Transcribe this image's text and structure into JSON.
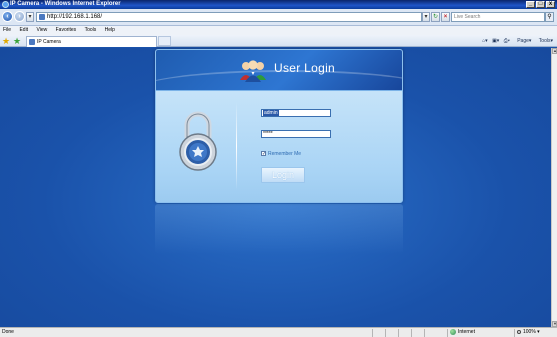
{
  "window": {
    "title": "IP Camera - Windows Internet Explorer",
    "minimize_glyph": "_",
    "maximize_glyph": "□",
    "close_glyph": "x"
  },
  "address_bar": {
    "url": "http://192.168.1.168/",
    "back_icon": "back-arrow-icon",
    "forward_icon": "forward-arrow-icon",
    "refresh_icon": "refresh-icon",
    "stop_icon": "stop-icon"
  },
  "search": {
    "placeholder": "Live Search"
  },
  "menu": [
    "File",
    "Edit",
    "View",
    "Favorites",
    "Tools",
    "Help"
  ],
  "tab": {
    "label": "IP Camera"
  },
  "command_bar": {
    "page_label": "Page",
    "tools_label": "Tools"
  },
  "login": {
    "title": "User Login",
    "username_value": "admin",
    "password_value": "*****",
    "remember_label": "Remember Me",
    "remember_checked": true,
    "button_label": "Login"
  },
  "status_bar": {
    "status": "Done",
    "zone": "Internet",
    "zoom": "100%"
  },
  "colors": {
    "page_background": "#1a52aa",
    "login_header": "#2e76d2",
    "login_body": "#bfe0f8"
  }
}
